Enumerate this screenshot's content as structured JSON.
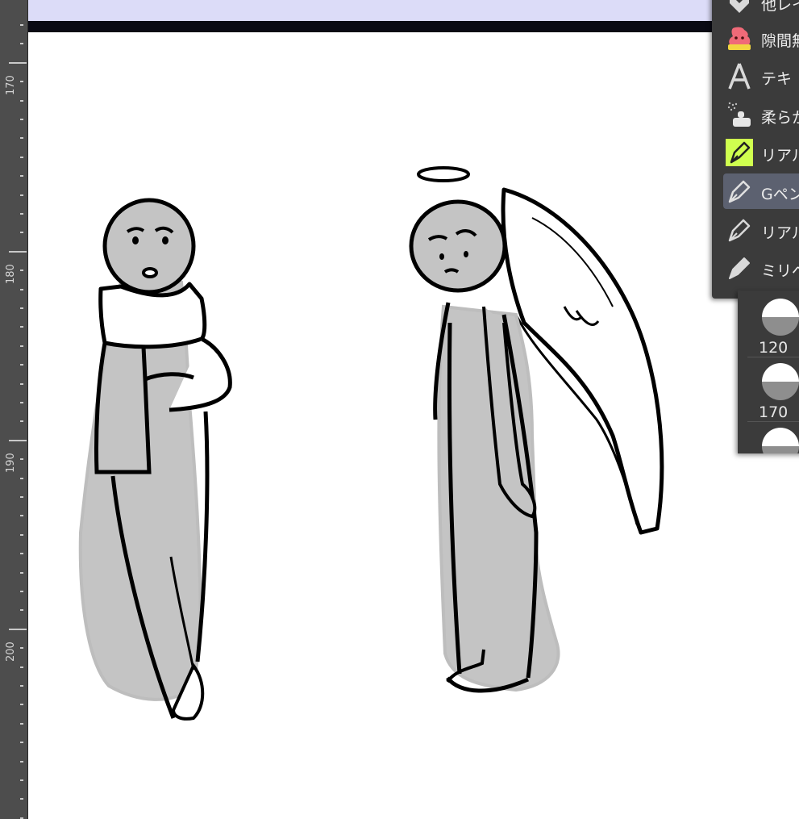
{
  "ruler": {
    "labels": [
      "170",
      "180",
      "190",
      "200"
    ]
  },
  "subtool_panel": {
    "items": [
      {
        "label": "他レイ",
        "icon": "fill-other-layer-icon"
      },
      {
        "label": "隙間無",
        "icon": "fill-gap-closing-icon"
      },
      {
        "label": "テキ",
        "icon": "text-tool-icon"
      },
      {
        "label": "柔らか",
        "icon": "soft-airbrush-icon"
      },
      {
        "label": "リアル",
        "icon": "real-gpen-icon"
      },
      {
        "label": "Gペン",
        "icon": "gpen-icon",
        "selected": true
      },
      {
        "label": "リアル",
        "icon": "real-pen-icon"
      },
      {
        "label": "ミリペ",
        "icon": "millipen-icon"
      }
    ]
  },
  "brush_size_panel": {
    "sizes": [
      "120",
      "170",
      ""
    ]
  }
}
